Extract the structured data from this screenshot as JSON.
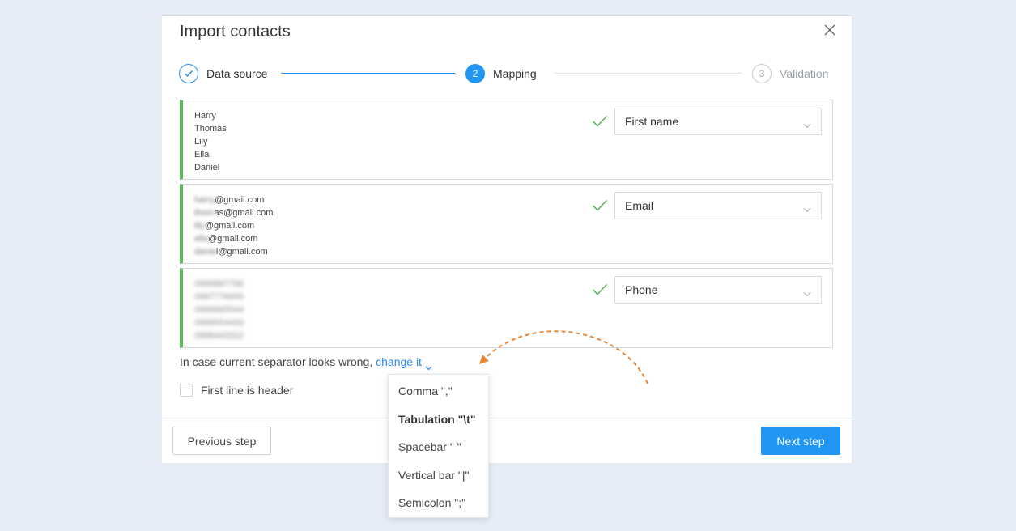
{
  "modal": {
    "title": "Import contacts"
  },
  "stepper": {
    "steps": [
      {
        "number": "",
        "label": "Data source",
        "state": "completed"
      },
      {
        "number": "2",
        "label": "Mapping",
        "state": "active"
      },
      {
        "number": "3",
        "label": "Validation",
        "state": "pending"
      }
    ]
  },
  "mapping_rows": [
    {
      "samples": [
        {
          "visible": "Harry"
        },
        {
          "visible": "Thomas"
        },
        {
          "visible": "Lily"
        },
        {
          "visible": "Ella"
        },
        {
          "visible": "Daniel"
        }
      ],
      "field": "First name"
    },
    {
      "samples": [
        {
          "visible": "@gmail.com"
        },
        {
          "visible": "as@gmail.com"
        },
        {
          "visible": "@gmail.com"
        },
        {
          "visible": "@gmail.com"
        },
        {
          "visible": "l@gmail.com"
        }
      ],
      "field": "Email"
    },
    {
      "samples": [
        {
          "visible": ""
        },
        {
          "visible": ""
        },
        {
          "visible": ""
        },
        {
          "visible": ""
        },
        {
          "visible": ""
        }
      ],
      "field": "Phone"
    }
  ],
  "separator": {
    "prompt": "In case current separator looks wrong,",
    "link_label": "change it"
  },
  "header_checkbox": {
    "label": "First line is header",
    "checked": false
  },
  "footer": {
    "previous_label": "Previous step",
    "next_label": "Next step"
  },
  "separator_dropdown": {
    "selected_index": 1,
    "options": [
      "Comma \",\"",
      "Tabulation \"\\t\"",
      "Spacebar \" \"",
      "Vertical bar \"|\"",
      "Semicolon \";\""
    ]
  },
  "colors": {
    "accent": "#2196f3",
    "success": "#5cb85c",
    "annotation": "#e8893a",
    "background": "#e6edf6"
  }
}
